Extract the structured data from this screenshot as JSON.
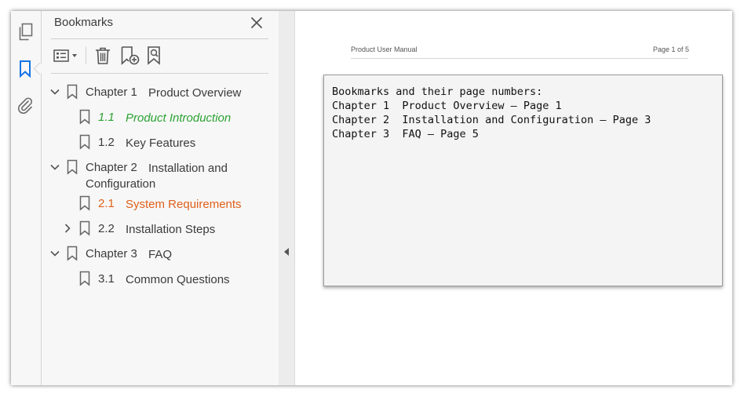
{
  "sidebar": {
    "title": "Bookmarks",
    "toolbar": {
      "options_icon": "list-options-icon",
      "delete_icon": "trash-icon",
      "new_bookmark_icon": "add-bookmark-icon",
      "find_bookmark_icon": "find-bookmark-icon"
    },
    "bookmarks": [
      {
        "number": "Chapter 1",
        "title": "Product Overview",
        "expanded": true,
        "children": [
          {
            "number": "1.1",
            "title": "Product Introduction",
            "color": "#2ba233",
            "italic": true
          },
          {
            "number": "1.2",
            "title": "Key Features"
          }
        ]
      },
      {
        "number": "Chapter 2",
        "title": "Installation and",
        "title_line2": "Configuration",
        "expanded": true,
        "children": [
          {
            "number": "2.1",
            "title": "System Requirements",
            "color": "#e0601b"
          },
          {
            "number": "2.2",
            "title": "Installation Steps",
            "expanded": false
          }
        ]
      },
      {
        "number": "Chapter 3",
        "title": "FAQ",
        "expanded": true,
        "children": [
          {
            "number": "3.1",
            "title": "Common Questions"
          }
        ]
      }
    ]
  },
  "document": {
    "header_left": "Product User Manual",
    "header_right": "Page 1 of 5",
    "textbox_lines": [
      "Bookmarks and their page numbers:",
      "Chapter 1  Product Overview — Page 1",
      "Chapter 2  Installation and Configuration — Page 3",
      "Chapter 3  FAQ — Page 5"
    ]
  },
  "colors": {
    "accent_blue": "#1473e6",
    "green_bookmark": "#2ba233",
    "orange_bookmark": "#e0601b"
  }
}
